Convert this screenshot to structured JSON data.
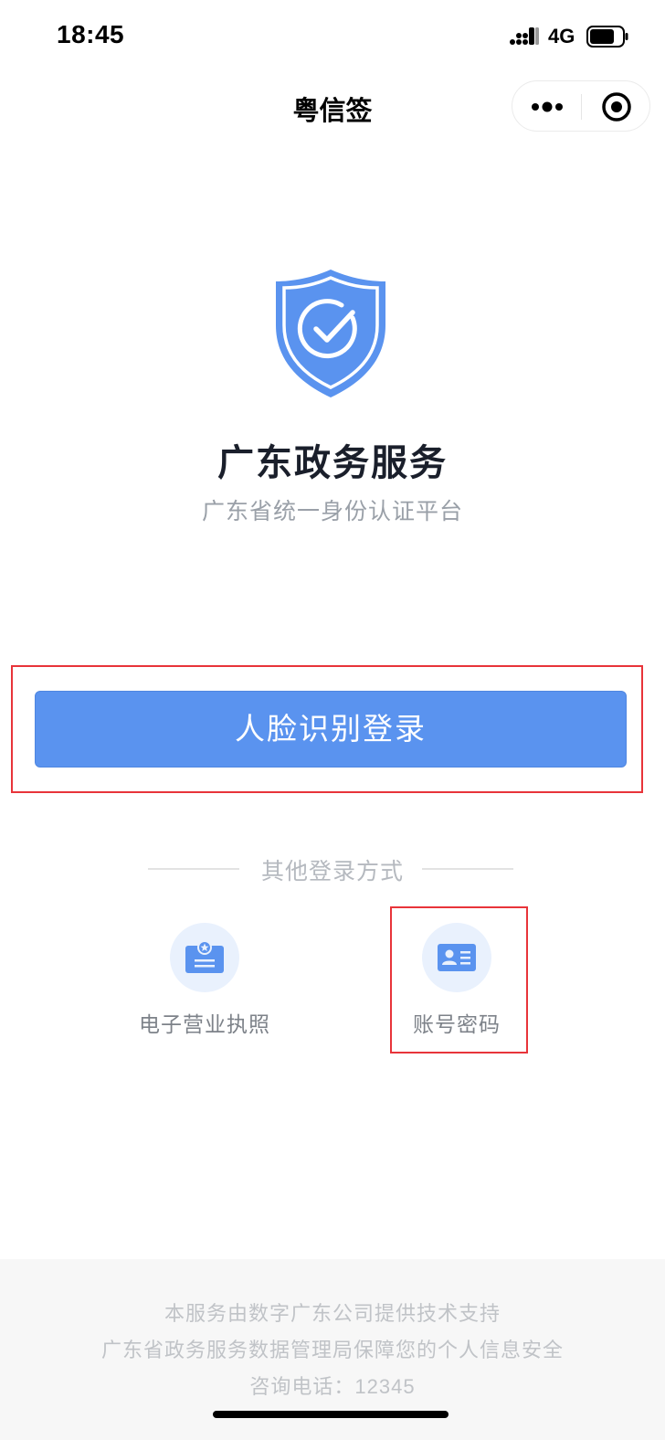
{
  "status_bar": {
    "time": "18:45",
    "network": "4G"
  },
  "nav": {
    "title": "粤信签",
    "more_icon": "more-dots-icon",
    "close_icon": "mini-program-close-icon"
  },
  "hero": {
    "logo_icon": "shield-check-icon",
    "title": "广东政务服务",
    "subtitle": "广东省统一身份认证平台",
    "accent_color": "#5a93ef"
  },
  "login": {
    "face_button_label": "人脸识别登录"
  },
  "other_methods": {
    "label": "其他登录方式",
    "options": [
      {
        "label": "电子营业执照",
        "icon": "business-license-icon"
      },
      {
        "label": "账号密码",
        "icon": "id-card-icon"
      }
    ]
  },
  "footer": {
    "line1": "本服务由数字广东公司提供技术支持",
    "line2": "广东省政务服务数据管理局保障您的个人信息安全",
    "line3": "咨询电话：12345"
  }
}
